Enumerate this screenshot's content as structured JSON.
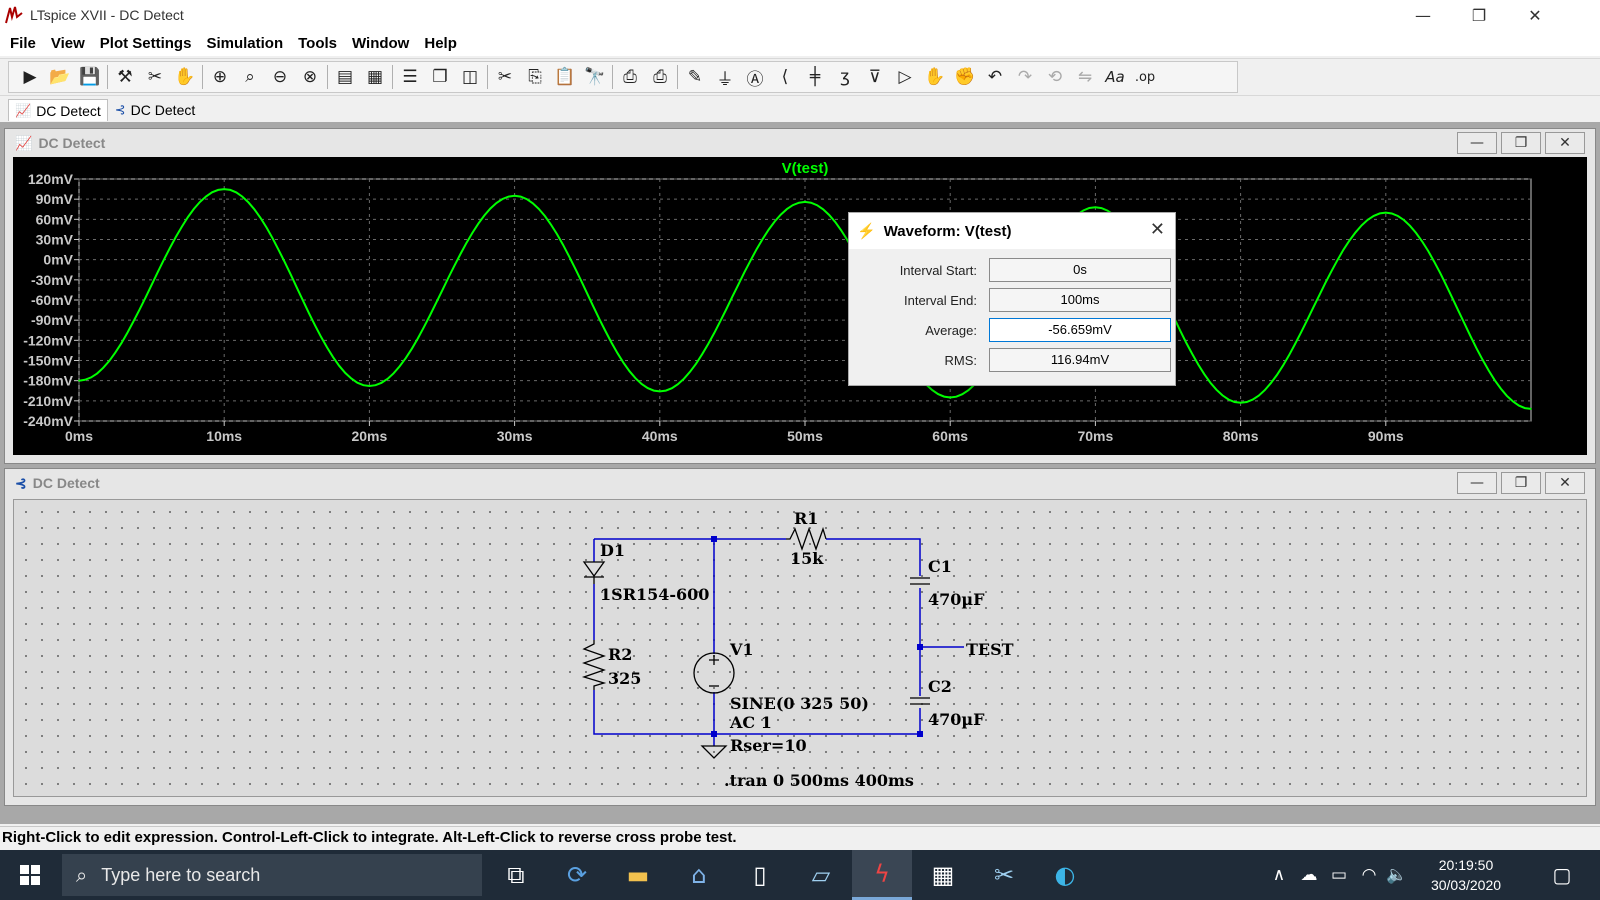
{
  "window": {
    "title": "LTspice XVII - DC Detect",
    "minimize": "—",
    "restore": "❐",
    "close": "✕"
  },
  "menu": [
    "File",
    "View",
    "Plot Settings",
    "Simulation",
    "Tools",
    "Window",
    "Help"
  ],
  "toolbar": {
    "group1": [
      "run-icon",
      "open-icon",
      "save-icon"
    ],
    "group2": [
      "control-panel-icon",
      "halt-icon",
      "pan-icon"
    ],
    "group3": [
      "zoom-in-icon",
      "zoom-area-icon",
      "zoom-out-icon",
      "zoom-cancel-icon"
    ],
    "group4": [
      "autorange-icon",
      "grid-icon"
    ],
    "group5": [
      "tile-horizontal-icon",
      "cascade-icon",
      "tile-vertical-icon"
    ],
    "group6": [
      "cut-icon",
      "copy-icon",
      "paste-icon",
      "find-icon"
    ],
    "group7": [
      "print-icon",
      "print-setup-icon"
    ],
    "group8": [
      "draw-wire-icon",
      "ground-icon",
      "label-net-icon",
      "resistor-icon",
      "capacitor-icon",
      "inductor-icon",
      "diode-icon",
      "component-icon",
      "move-icon",
      "drag-icon",
      "undo-icon",
      "redo-icon",
      "rotate-icon",
      "mirror-icon",
      "text-icon",
      "spice-directive-icon"
    ]
  },
  "tabs": [
    {
      "label": "DC Detect",
      "icon": "waveform-icon",
      "active": true
    },
    {
      "label": "DC Detect",
      "icon": "schematic-icon",
      "active": false
    }
  ],
  "plot_window": {
    "title": "DC Detect",
    "trace_label": "V(test)",
    "trace_color": "#00ff00"
  },
  "chart_data": {
    "type": "line",
    "title": "V(test)",
    "xlabel": "",
    "ylabel": "",
    "x_ticks": [
      "0ms",
      "10ms",
      "20ms",
      "30ms",
      "40ms",
      "50ms",
      "60ms",
      "70ms",
      "80ms",
      "90ms"
    ],
    "y_ticks": [
      "120mV",
      "90mV",
      "60mV",
      "30mV",
      "0mV",
      "-30mV",
      "-60mV",
      "-90mV",
      "-120mV",
      "-150mV",
      "-180mV",
      "-210mV",
      "-240mV"
    ],
    "xlim": [
      0,
      100
    ],
    "ylim": [
      -240,
      120
    ],
    "x_unit": "ms",
    "y_unit": "mV",
    "grid": true,
    "series": [
      {
        "name": "V(test)",
        "color": "#00ff00",
        "points": [
          [
            0,
            -180
          ],
          [
            10,
            105
          ],
          [
            20,
            -188
          ],
          [
            30,
            95
          ],
          [
            40,
            -196
          ],
          [
            50,
            86
          ],
          [
            60,
            -205
          ],
          [
            70,
            78
          ],
          [
            80,
            -213
          ],
          [
            90,
            70
          ],
          [
            100,
            -222
          ]
        ]
      }
    ]
  },
  "dialog": {
    "title": "Waveform: V(test)",
    "close": "✕",
    "fields": [
      {
        "label": "Interval Start:",
        "value": "0s"
      },
      {
        "label": "Interval End:",
        "value": "100ms"
      },
      {
        "label": "Average:",
        "value": "-56.659mV"
      },
      {
        "label": "RMS:",
        "value": "116.94mV"
      }
    ]
  },
  "schematic_window": {
    "title": "DC Detect"
  },
  "schematic": {
    "D1": {
      "name": "D1",
      "value": "1SR154-600"
    },
    "R1": {
      "name": "R1",
      "value": "15k"
    },
    "R2": {
      "name": "R2",
      "value": "325"
    },
    "C1": {
      "name": "C1",
      "value": "470µF"
    },
    "C2": {
      "name": "C2",
      "value": "470µF"
    },
    "V1": {
      "name": "V1",
      "line1": "SINE(0 325 50)",
      "line2": "AC 1",
      "line3": "Rser=10"
    },
    "net_label": "TEST",
    "directive": ".tran 0 500ms 400ms",
    "wire_color": "#0000cc"
  },
  "status": "Right-Click to edit expression. Control-Left-Click to integrate. Alt-Left-Click to reverse cross probe test.",
  "taskbar": {
    "search_placeholder": "Type here to search",
    "apps": [
      "task-view-icon",
      "sync-icon",
      "file-explorer-icon",
      "bank-icon",
      "document-icon",
      "notepad-icon",
      "ltspice-icon",
      "calculator-icon",
      "snipping-tool-icon",
      "edge-icon"
    ],
    "time": "20:19:50",
    "date": "30/03/2020"
  }
}
